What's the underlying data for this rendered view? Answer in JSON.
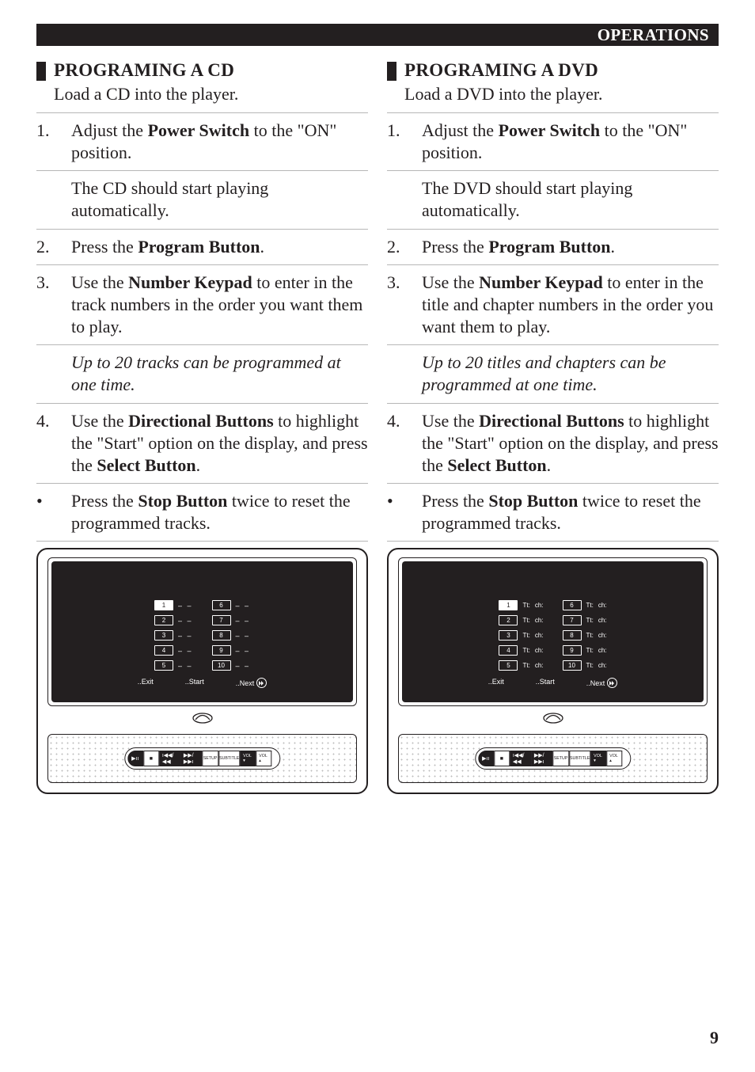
{
  "header_bar": "OPERATIONS",
  "page_number": "9",
  "cd": {
    "title": "PROGRAMING A CD",
    "intro": "Load a CD into the player.",
    "step1_pre": "Adjust the ",
    "step1_bold": "Power Switch",
    "step1_post": " to the \"ON\" position.",
    "sub1": "The CD should start playing automatically.",
    "step2_pre": "Press the ",
    "step2_bold": "Program Button",
    "step2_post": ".",
    "step3_pre": "Use the ",
    "step3_bold": "Number Keypad",
    "step3_post": " to enter in the track numbers in the order you want them to play.",
    "sub3_italic": "Up to 20 tracks can be programmed at one time.",
    "step4_pre": "Use the ",
    "step4_bold1": "Directional Buttons",
    "step4_mid": " to highlight the \"Start\" option on the display, and press the ",
    "step4_bold2": "Select Button",
    "step4_post": ".",
    "bullet_pre": "Press the ",
    "bullet_bold": "Stop Button",
    "bullet_post": " twice to reset the programmed tracks."
  },
  "dvd": {
    "title": "PROGRAMING A DVD",
    "intro": "Load a DVD into the player.",
    "step1_pre": "Adjust the ",
    "step1_bold": "Power Switch",
    "step1_post": " to the \"ON\" position.",
    "sub1": "The DVD should start playing automatically.",
    "step2_pre": "Press the ",
    "step2_bold": "Program Button",
    "step2_post": ".",
    "step3_pre": "Use the ",
    "step3_bold": "Number Keypad",
    "step3_post": " to enter in the title and chapter numbers in the order you want them to play.",
    "sub3_italic": "Up to 20 titles and chapters can be programmed at one time.",
    "step4_pre": "Use the ",
    "step4_bold1": "Directional Buttons",
    "step4_mid": " to highlight the \"Start\" option on the display, and press the ",
    "step4_bold2": "Select Button",
    "step4_post": ".",
    "bullet_pre": "Press the ",
    "bullet_bold": "Stop Button",
    "bullet_post": " twice to reset the programmed tracks."
  },
  "osd": {
    "slots_left": [
      "1",
      "2",
      "3",
      "4",
      "5"
    ],
    "slots_right": [
      "6",
      "7",
      "8",
      "9",
      "10"
    ],
    "dashes": "– –",
    "tt": "Tt:",
    "ch": "ch:",
    "exit": "..Exit",
    "start": "..Start",
    "next": "..Next"
  },
  "buttons": {
    "play": "▶ıı",
    "stop": "■",
    "rew": "ı◀◀/◀◀",
    "fwd": "▶▶/▶▶ı",
    "setup": "SETUP",
    "subtitle": "SUBTITLE",
    "voldown": "VOL ▾",
    "volup": "VOL ▴"
  }
}
